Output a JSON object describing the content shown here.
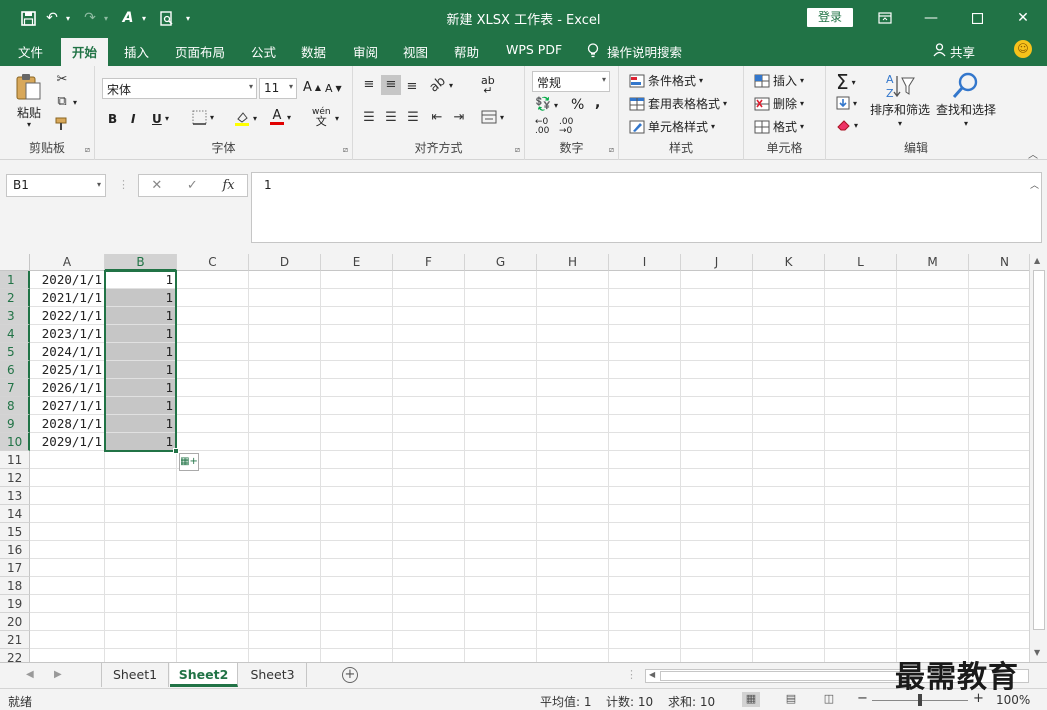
{
  "app": {
    "title": "新建 XLSX 工作表 - Excel",
    "login_label": "登录"
  },
  "colors": {
    "accent": "#217346",
    "selection_fill": "#c6c6c6"
  },
  "tabs": [
    {
      "label": "文件"
    },
    {
      "label": "开始"
    },
    {
      "label": "插入"
    },
    {
      "label": "页面布局"
    },
    {
      "label": "公式"
    },
    {
      "label": "数据"
    },
    {
      "label": "审阅"
    },
    {
      "label": "视图"
    },
    {
      "label": "帮助"
    },
    {
      "label": "WPS PDF"
    }
  ],
  "tell_me": "操作说明搜索",
  "share_label": "共享",
  "ribbon": {
    "clipboard": {
      "label": "剪贴板",
      "paste": "粘贴"
    },
    "font": {
      "label": "字体",
      "font_name": "宋体",
      "font_size": "11",
      "bold": "B",
      "italic": "I",
      "underline": "U"
    },
    "alignment": {
      "label": "对齐方式"
    },
    "number": {
      "label": "数字",
      "format": "常规"
    },
    "styles": {
      "label": "样式",
      "conditional": "条件格式",
      "table": "套用表格格式",
      "cell_styles": "单元格样式"
    },
    "cells": {
      "label": "单元格",
      "insert": "插入",
      "delete": "删除",
      "format": "格式"
    },
    "editing": {
      "label": "编辑",
      "sort_filter": "排序和筛选",
      "find_select": "查找和选择"
    }
  },
  "formula_bar": {
    "name_box": "B1",
    "fx": "fx",
    "value": "1"
  },
  "columns": [
    "A",
    "B",
    "C",
    "D",
    "E",
    "F",
    "G",
    "H",
    "I",
    "J",
    "K",
    "L",
    "M",
    "N"
  ],
  "rows": [
    "1",
    "2",
    "3",
    "4",
    "5",
    "6",
    "7",
    "8",
    "9",
    "10",
    "11",
    "12",
    "13",
    "14",
    "15",
    "16",
    "17",
    "18",
    "19",
    "20",
    "21",
    "22"
  ],
  "cells": {
    "A": [
      "2020/1/1",
      "2021/1/1",
      "2022/1/1",
      "2023/1/1",
      "2024/1/1",
      "2025/1/1",
      "2026/1/1",
      "2027/1/1",
      "2028/1/1",
      "2029/1/1"
    ],
    "B": [
      "1",
      "1",
      "1",
      "1",
      "1",
      "1",
      "1",
      "1",
      "1",
      "1"
    ]
  },
  "sheets": [
    {
      "name": "Sheet1"
    },
    {
      "name": "Sheet2"
    },
    {
      "name": "Sheet3"
    }
  ],
  "status": {
    "ready": "就绪",
    "average": "平均值: 1",
    "count": "计数: 10",
    "sum": "求和: 10",
    "zoom": "100%"
  },
  "watermark": "最需教育"
}
